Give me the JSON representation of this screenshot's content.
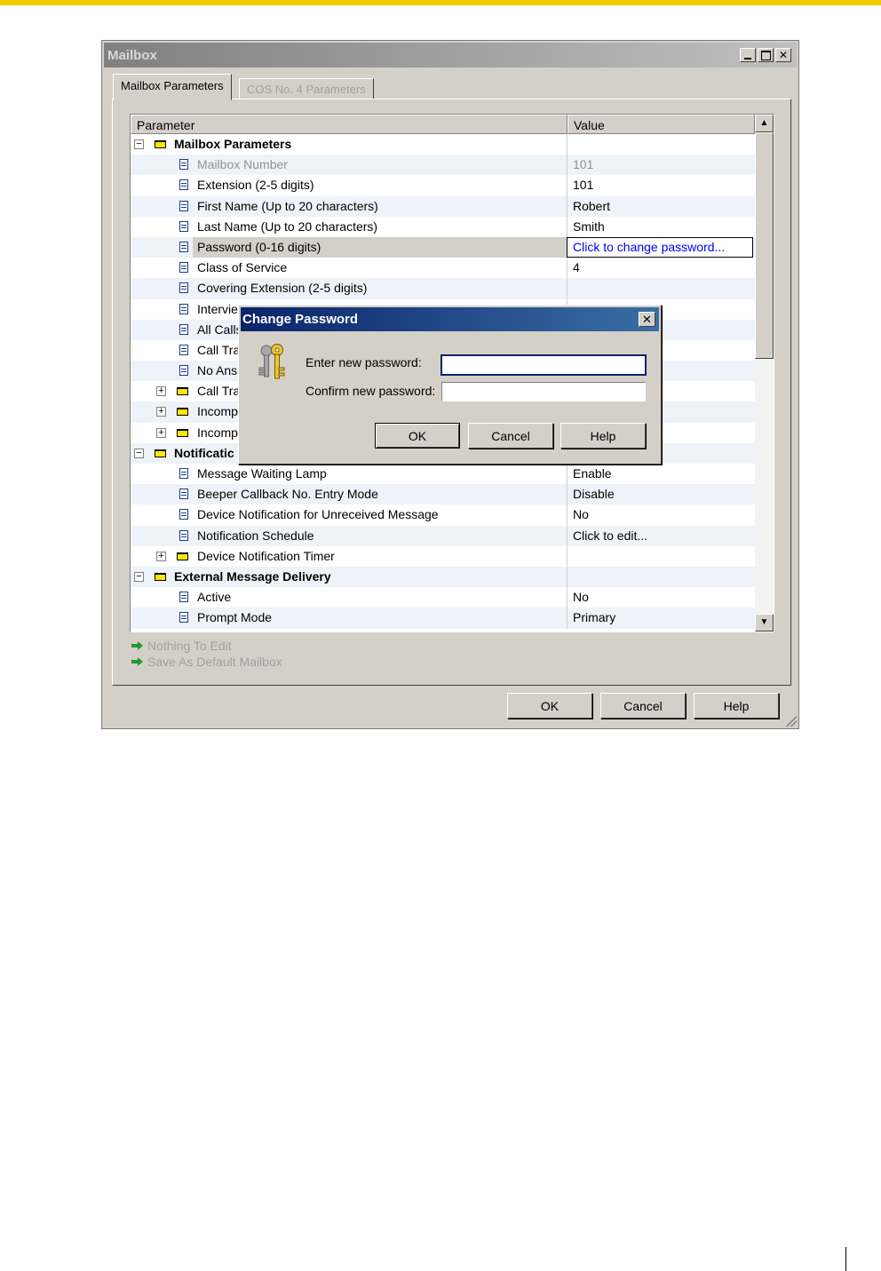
{
  "window": {
    "title": "Mailbox"
  },
  "tabs": [
    {
      "label": "Mailbox Parameters",
      "active": true
    },
    {
      "label": "COS No. 4 Parameters",
      "active": false
    }
  ],
  "grid": {
    "col_parameter": "Parameter",
    "col_value": "Value",
    "rows": [
      {
        "label": "Mailbox Parameters",
        "value": ""
      },
      {
        "label": "Mailbox Number",
        "value": "101"
      },
      {
        "label": "Extension (2-5 digits)",
        "value": "101"
      },
      {
        "label": "First Name (Up to 20 characters)",
        "value": "Robert"
      },
      {
        "label": "Last Name (Up to 20 characters)",
        "value": "Smith"
      },
      {
        "label": "Password (0-16 digits)",
        "value": "Click to change password..."
      },
      {
        "label": "Class of Service",
        "value": "4"
      },
      {
        "label": "Covering Extension (2-5 digits)",
        "value": ""
      },
      {
        "label": "Intervie",
        "value": ""
      },
      {
        "label": "All Calls",
        "value": ""
      },
      {
        "label": "Call Tra",
        "value": ""
      },
      {
        "label": "No Ans",
        "value": ""
      },
      {
        "label": "Call Tra",
        "value": ""
      },
      {
        "label": "Incomp",
        "value": ""
      },
      {
        "label": "Incomp",
        "value": ""
      },
      {
        "label": "Notificatic",
        "value": ""
      },
      {
        "label": "Message Waiting Lamp",
        "value": "Enable"
      },
      {
        "label": "Beeper Callback No. Entry Mode",
        "value": "Disable"
      },
      {
        "label": "Device Notification for Unreceived Message",
        "value": "No"
      },
      {
        "label": "Notification Schedule",
        "value": "Click to edit..."
      },
      {
        "label": "Device Notification Timer",
        "value": ""
      },
      {
        "label": "External Message Delivery",
        "value": ""
      },
      {
        "label": "Active",
        "value": "No"
      },
      {
        "label": "Prompt Mode",
        "value": "Primary"
      }
    ]
  },
  "links": {
    "nothing_to_edit": "Nothing To Edit",
    "save_default": "Save As Default Mailbox"
  },
  "footer": {
    "ok": "OK",
    "cancel": "Cancel",
    "help": "Help"
  },
  "dialog": {
    "title": "Change Password",
    "close": "✕",
    "enter_label": "Enter new password:",
    "confirm_label": "Confirm new password:",
    "new_password": "",
    "confirm_password": "",
    "ok": "OK",
    "cancel": "Cancel",
    "help": "Help"
  },
  "colors": {
    "accent_bar": "#f1c900",
    "dialog_title": "#0a246a",
    "link_blue": "#0000ee",
    "folder_yellow": "#ffe600"
  }
}
